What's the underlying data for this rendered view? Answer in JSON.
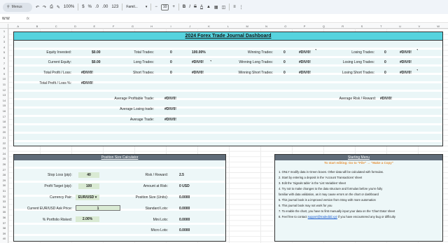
{
  "toolbar": {
    "search_label": "Menus",
    "zoom": "100%",
    "currency": "$",
    "percent": "%",
    "dec_less": ".0",
    "dec_more": ".00",
    "number_format": "123",
    "font_family": "Famil...",
    "font_size": "10",
    "bold": "B",
    "italic": "I",
    "strike": "S",
    "text_color": "A"
  },
  "formula_bar": {
    "cell_ref": "W:W",
    "fx": "fx"
  },
  "columns": [
    "A",
    "B",
    "C",
    "D",
    "E",
    "F",
    "G",
    "H",
    "I",
    "J",
    "K",
    "L",
    "M",
    "N",
    "O",
    "P",
    "Q",
    "R",
    "S",
    "T",
    "U",
    "V",
    "W"
  ],
  "rows": [
    "1",
    "2",
    "3",
    "4",
    "5",
    "6",
    "7",
    "8",
    "9",
    "10",
    "11",
    "12",
    "13",
    "14",
    "15",
    "16",
    "17",
    "18",
    "19",
    "20",
    "21",
    "22",
    "23",
    "24",
    "25",
    "26",
    "27",
    "28",
    "29",
    "30",
    "31",
    "32",
    "33",
    "34",
    "35",
    "36",
    "37",
    "38",
    "39",
    "40"
  ],
  "dashboard": {
    "title": "2024 Forex Trade Journal Dashboard",
    "equity_invested_label": "Equity Invested:",
    "equity_invested_value": "$0.00",
    "current_equity_label": "Current Equity:",
    "current_equity_value": "$0.00",
    "total_pl_label": "Total Profit / Loss:",
    "total_pl_value": "#DIV/0!",
    "total_pl_pct_label": "Total Profit / Loss %:",
    "total_pl_pct_value": "#DIV/0!",
    "total_trades_label": "Total Trades:",
    "total_trades_value": "0",
    "total_trades_pct": "100.00%",
    "long_trades_label": "Long Trades:",
    "long_trades_value": "0",
    "long_trades_pct": "#DIV/0!",
    "short_trades_label": "Short Trades:",
    "short_trades_value": "0",
    "short_trades_pct": "#DIV/0!",
    "winning_trades_label": "Winning Trades:",
    "winning_trades_value": "0",
    "winning_trades_pct": "#DIV/0!",
    "winning_long_label": "Winning Long Trades:",
    "winning_long_value": "0",
    "winning_long_pct": "#DIV/0!",
    "winning_short_label": "Winning Short Trades:",
    "winning_short_value": "0",
    "winning_short_pct": "#DIV/0!",
    "losing_trades_label": "Losing Trades:",
    "losing_trades_value": "0",
    "losing_trades_pct": "#DIV/0!",
    "losing_long_label": "Losing Long Trades:",
    "losing_long_value": "0",
    "losing_long_pct": "#DIV/0!",
    "losing_short_label": "Losing Short Trades:",
    "losing_short_value": "0",
    "losing_short_pct": "#DIV/0!",
    "avg_profitable_label": "Average Profitable Trade:",
    "avg_profitable_value": "#DIV/0!",
    "avg_losing_label": "Average Losing trade:",
    "avg_losing_value": "#DIV/0!",
    "avg_trade_label": "Average Trade:",
    "avg_trade_value": "#DIV/0!",
    "avg_rr_label": "Average Risk / Reward:",
    "avg_rr_value": "#DIV/0!"
  },
  "calculator": {
    "title": "Position Size Calculator",
    "stop_loss_label": "Stop Loss (pip):",
    "stop_loss_value": "40",
    "profit_target_label": "Profit Target (pip):",
    "profit_target_value": "100",
    "currency_pair_label": "Currency Pair:",
    "currency_pair_value": "EUR/USD",
    "ask_price_label": "Current EUR/USD Ask Price:",
    "ask_price_value": "1",
    "portfolio_risked_label": "% Portfolio Risked:",
    "portfolio_risked_value": "2.00%",
    "risk_reward_label": "Risk / Reward:",
    "risk_reward_value": "2.5",
    "amount_at_risk_label": "Amount at Risk:",
    "amount_at_risk_value": "0 USD",
    "position_size_label": "Position Size (Units):",
    "position_size_value": "0.0000",
    "standard_lots_label": "Standard Lots:",
    "standard_lots_value": "0.0000",
    "mini_lots_label": "Mini Lots:",
    "mini_lots_value": "0.0000",
    "micro_lots_label": "Micro Lots:",
    "micro_lots_value": "0.0000"
  },
  "menu": {
    "title": "Starting Menu",
    "subtitle": "To start editing: Go to \"File\" → \"Make a Copy\"",
    "lines": [
      "1. ONLY modify data in Green boxes. Other data will be calculated with formulas.",
      "2. Start by entering a deposit in the 'Account Transactions' sheet",
      "3. Edit the 'Signals table' in the 'List Variables' sheet",
      "4. Try not to make changes to the data structure and formulas before you're fully",
      "familiar with data validation, as it may cause errors on the chart or dashboard",
      "5. This journal book is a improved version from Stray with more automation",
      "6. This journal book may not work for you",
      "7. To enable the chart, you have to first manually input your data on the 'Chart Data' sheet"
    ],
    "line8_prefix": "8. Feel free to contact",
    "line8_link": "support@tradeddd.xyz",
    "line8_suffix": "if you have encountered any bug or difficulty"
  },
  "colors": {
    "dashboard_title_bg": "#56d3de",
    "panel_bg": "#eaf6f7",
    "calc_header_bg": "#5f6b78",
    "input_green": "#d9ead3",
    "menu_subtitle": "#e69138"
  }
}
